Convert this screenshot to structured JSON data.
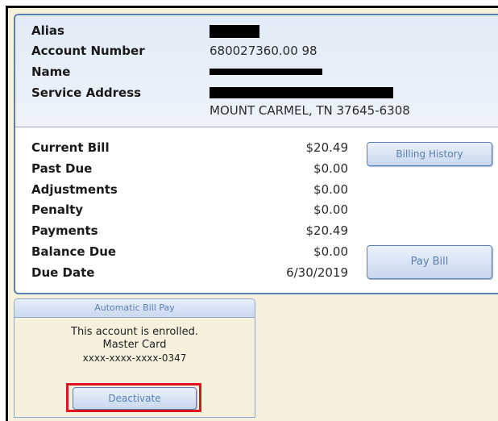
{
  "account": {
    "alias_label": "Alias",
    "account_number_label": "Account Number",
    "account_number": "680027360.00 98",
    "name_label": "Name",
    "service_address_label": "Service Address",
    "service_address_line2": "MOUNT CARMEL, TN 37645-6308"
  },
  "billing": {
    "rows": [
      {
        "label": "Current Bill",
        "value": "$20.49"
      },
      {
        "label": "Past Due",
        "value": "$0.00"
      },
      {
        "label": "Adjustments",
        "value": "$0.00"
      },
      {
        "label": "Penalty",
        "value": "$0.00"
      },
      {
        "label": "Payments",
        "value": "$20.49"
      },
      {
        "label": "Balance Due",
        "value": "$0.00"
      },
      {
        "label": "Due Date",
        "value": "6/30/2019"
      }
    ],
    "billing_history_button": "Billing History",
    "pay_bill_button": "Pay Bill"
  },
  "auto_pay": {
    "title": "Automatic Bill Pay",
    "status": "This account is enrolled.",
    "card_type": "Master Card",
    "card_number": "xxxx-xxxx-xxxx-0347",
    "deactivate_button": "Deactivate"
  },
  "colors": {
    "accent_blue": "#5b7fb3",
    "panel_background": "#f5f1dd",
    "highlight_red": "#e0141e"
  }
}
